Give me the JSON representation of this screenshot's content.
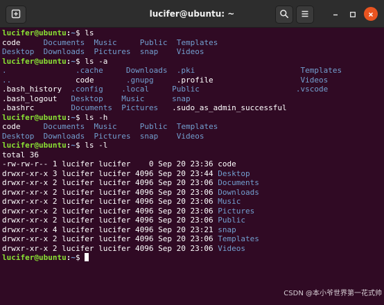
{
  "window": {
    "title": "lucifer@ubuntu: ~"
  },
  "titlebar": {
    "new_tab_icon": "new-tab-icon",
    "search_icon": "search-icon",
    "menu_icon": "hamburger-menu-icon",
    "minimize_icon": "minimize-icon",
    "maximize_icon": "maximize-icon",
    "close_icon": "close-icon"
  },
  "colors": {
    "background": "#300a24",
    "titlebar": "#2d2d2d",
    "prompt_user": "#8ae234",
    "prompt_path": "#729fcf",
    "directory": "#729fcf",
    "text": "#ffffff",
    "close_button": "#e95420"
  },
  "terminal": {
    "lines": [
      [
        {
          "t": "lucifer@ubuntu",
          "c": "prompt-user"
        },
        {
          "t": ":",
          "c": "prompt-sep"
        },
        {
          "t": "~",
          "c": "prompt-path"
        },
        {
          "t": "$ ls",
          "c": "prompt-sym"
        }
      ],
      [
        {
          "t": "code     ",
          "c": "file"
        },
        {
          "t": "Documents",
          "c": "dir"
        },
        {
          "t": "  ",
          "c": "file"
        },
        {
          "t": "Music",
          "c": "dir"
        },
        {
          "t": "     ",
          "c": "file"
        },
        {
          "t": "Public",
          "c": "dir"
        },
        {
          "t": "  ",
          "c": "file"
        },
        {
          "t": "Templates",
          "c": "dir"
        }
      ],
      [
        {
          "t": "Desktop",
          "c": "dir"
        },
        {
          "t": "  ",
          "c": "file"
        },
        {
          "t": "Downloads",
          "c": "dir"
        },
        {
          "t": "  ",
          "c": "file"
        },
        {
          "t": "Pictures",
          "c": "dir"
        },
        {
          "t": "  ",
          "c": "file"
        },
        {
          "t": "snap",
          "c": "dir"
        },
        {
          "t": "    ",
          "c": "file"
        },
        {
          "t": "Videos",
          "c": "dir"
        }
      ],
      [
        {
          "t": "lucifer@ubuntu",
          "c": "prompt-user"
        },
        {
          "t": ":",
          "c": "prompt-sep"
        },
        {
          "t": "~",
          "c": "prompt-path"
        },
        {
          "t": "$ ls -a",
          "c": "prompt-sym"
        }
      ],
      [
        {
          "t": ".",
          "c": "dir"
        },
        {
          "t": "               ",
          "c": "file"
        },
        {
          "t": ".cache",
          "c": "dir"
        },
        {
          "t": "     ",
          "c": "file"
        },
        {
          "t": "Downloads",
          "c": "dir"
        },
        {
          "t": "  ",
          "c": "file"
        },
        {
          "t": ".pki",
          "c": "dir"
        },
        {
          "t": "                       ",
          "c": "file"
        },
        {
          "t": "Templates",
          "c": "dir"
        }
      ],
      [
        {
          "t": "..",
          "c": "dir"
        },
        {
          "t": "              ",
          "c": "file"
        },
        {
          "t": "code       ",
          "c": "file"
        },
        {
          "t": ".gnupg",
          "c": "dir"
        },
        {
          "t": "     ",
          "c": "file"
        },
        {
          "t": ".profile                   ",
          "c": "file"
        },
        {
          "t": "Videos",
          "c": "dir"
        }
      ],
      [
        {
          "t": ".bash_history  ",
          "c": "file"
        },
        {
          "t": ".config",
          "c": "dir"
        },
        {
          "t": "    ",
          "c": "file"
        },
        {
          "t": ".local",
          "c": "dir"
        },
        {
          "t": "     ",
          "c": "file"
        },
        {
          "t": "Public",
          "c": "dir"
        },
        {
          "t": "                     ",
          "c": "file"
        },
        {
          "t": ".vscode",
          "c": "dir"
        }
      ],
      [
        {
          "t": ".bash_logout   ",
          "c": "file"
        },
        {
          "t": "Desktop",
          "c": "dir"
        },
        {
          "t": "    ",
          "c": "file"
        },
        {
          "t": "Music",
          "c": "dir"
        },
        {
          "t": "      ",
          "c": "file"
        },
        {
          "t": "snap",
          "c": "dir"
        }
      ],
      [
        {
          "t": ".bashrc        ",
          "c": "file"
        },
        {
          "t": "Documents",
          "c": "dir"
        },
        {
          "t": "  ",
          "c": "file"
        },
        {
          "t": "Pictures",
          "c": "dir"
        },
        {
          "t": "   ",
          "c": "file"
        },
        {
          "t": ".sudo_as_admin_successful",
          "c": "file"
        }
      ],
      [
        {
          "t": "lucifer@ubuntu",
          "c": "prompt-user"
        },
        {
          "t": ":",
          "c": "prompt-sep"
        },
        {
          "t": "~",
          "c": "prompt-path"
        },
        {
          "t": "$ ls -h",
          "c": "prompt-sym"
        }
      ],
      [
        {
          "t": "code     ",
          "c": "file"
        },
        {
          "t": "Documents",
          "c": "dir"
        },
        {
          "t": "  ",
          "c": "file"
        },
        {
          "t": "Music",
          "c": "dir"
        },
        {
          "t": "     ",
          "c": "file"
        },
        {
          "t": "Public",
          "c": "dir"
        },
        {
          "t": "  ",
          "c": "file"
        },
        {
          "t": "Templates",
          "c": "dir"
        }
      ],
      [
        {
          "t": "Desktop",
          "c": "dir"
        },
        {
          "t": "  ",
          "c": "file"
        },
        {
          "t": "Downloads",
          "c": "dir"
        },
        {
          "t": "  ",
          "c": "file"
        },
        {
          "t": "Pictures",
          "c": "dir"
        },
        {
          "t": "  ",
          "c": "file"
        },
        {
          "t": "snap",
          "c": "dir"
        },
        {
          "t": "    ",
          "c": "file"
        },
        {
          "t": "Videos",
          "c": "dir"
        }
      ],
      [
        {
          "t": "lucifer@ubuntu",
          "c": "prompt-user"
        },
        {
          "t": ":",
          "c": "prompt-sep"
        },
        {
          "t": "~",
          "c": "prompt-path"
        },
        {
          "t": "$ ls -l",
          "c": "prompt-sym"
        }
      ],
      [
        {
          "t": "total 36",
          "c": "file"
        }
      ],
      [
        {
          "t": "-rw-rw-r-- 1 lucifer lucifer    0 Sep 20 23:36 code",
          "c": "file"
        }
      ],
      [
        {
          "t": "drwxr-xr-x 3 lucifer lucifer 4096 Sep 20 23:44 ",
          "c": "file"
        },
        {
          "t": "Desktop",
          "c": "dir"
        }
      ],
      [
        {
          "t": "drwxr-xr-x 2 lucifer lucifer 4096 Sep 20 23:06 ",
          "c": "file"
        },
        {
          "t": "Documents",
          "c": "dir"
        }
      ],
      [
        {
          "t": "drwxr-xr-x 2 lucifer lucifer 4096 Sep 20 23:06 ",
          "c": "file"
        },
        {
          "t": "Downloads",
          "c": "dir"
        }
      ],
      [
        {
          "t": "drwxr-xr-x 2 lucifer lucifer 4096 Sep 20 23:06 ",
          "c": "file"
        },
        {
          "t": "Music",
          "c": "dir"
        }
      ],
      [
        {
          "t": "drwxr-xr-x 2 lucifer lucifer 4096 Sep 20 23:06 ",
          "c": "file"
        },
        {
          "t": "Pictures",
          "c": "dir"
        }
      ],
      [
        {
          "t": "drwxr-xr-x 2 lucifer lucifer 4096 Sep 20 23:06 ",
          "c": "file"
        },
        {
          "t": "Public",
          "c": "dir"
        }
      ],
      [
        {
          "t": "drwxr-xr-x 4 lucifer lucifer 4096 Sep 20 23:21 ",
          "c": "file"
        },
        {
          "t": "snap",
          "c": "dir"
        }
      ],
      [
        {
          "t": "drwxr-xr-x 2 lucifer lucifer 4096 Sep 20 23:06 ",
          "c": "file"
        },
        {
          "t": "Templates",
          "c": "dir"
        }
      ],
      [
        {
          "t": "drwxr-xr-x 2 lucifer lucifer 4096 Sep 20 23:06 ",
          "c": "file"
        },
        {
          "t": "Videos",
          "c": "dir"
        }
      ],
      [
        {
          "t": "lucifer@ubuntu",
          "c": "prompt-user"
        },
        {
          "t": ":",
          "c": "prompt-sep"
        },
        {
          "t": "~",
          "c": "prompt-path"
        },
        {
          "t": "$ ",
          "c": "prompt-sym"
        },
        {
          "t": "",
          "c": "cursor"
        }
      ]
    ]
  },
  "watermark": {
    "text": "CSDN @本小爷世界第一花式帅"
  }
}
